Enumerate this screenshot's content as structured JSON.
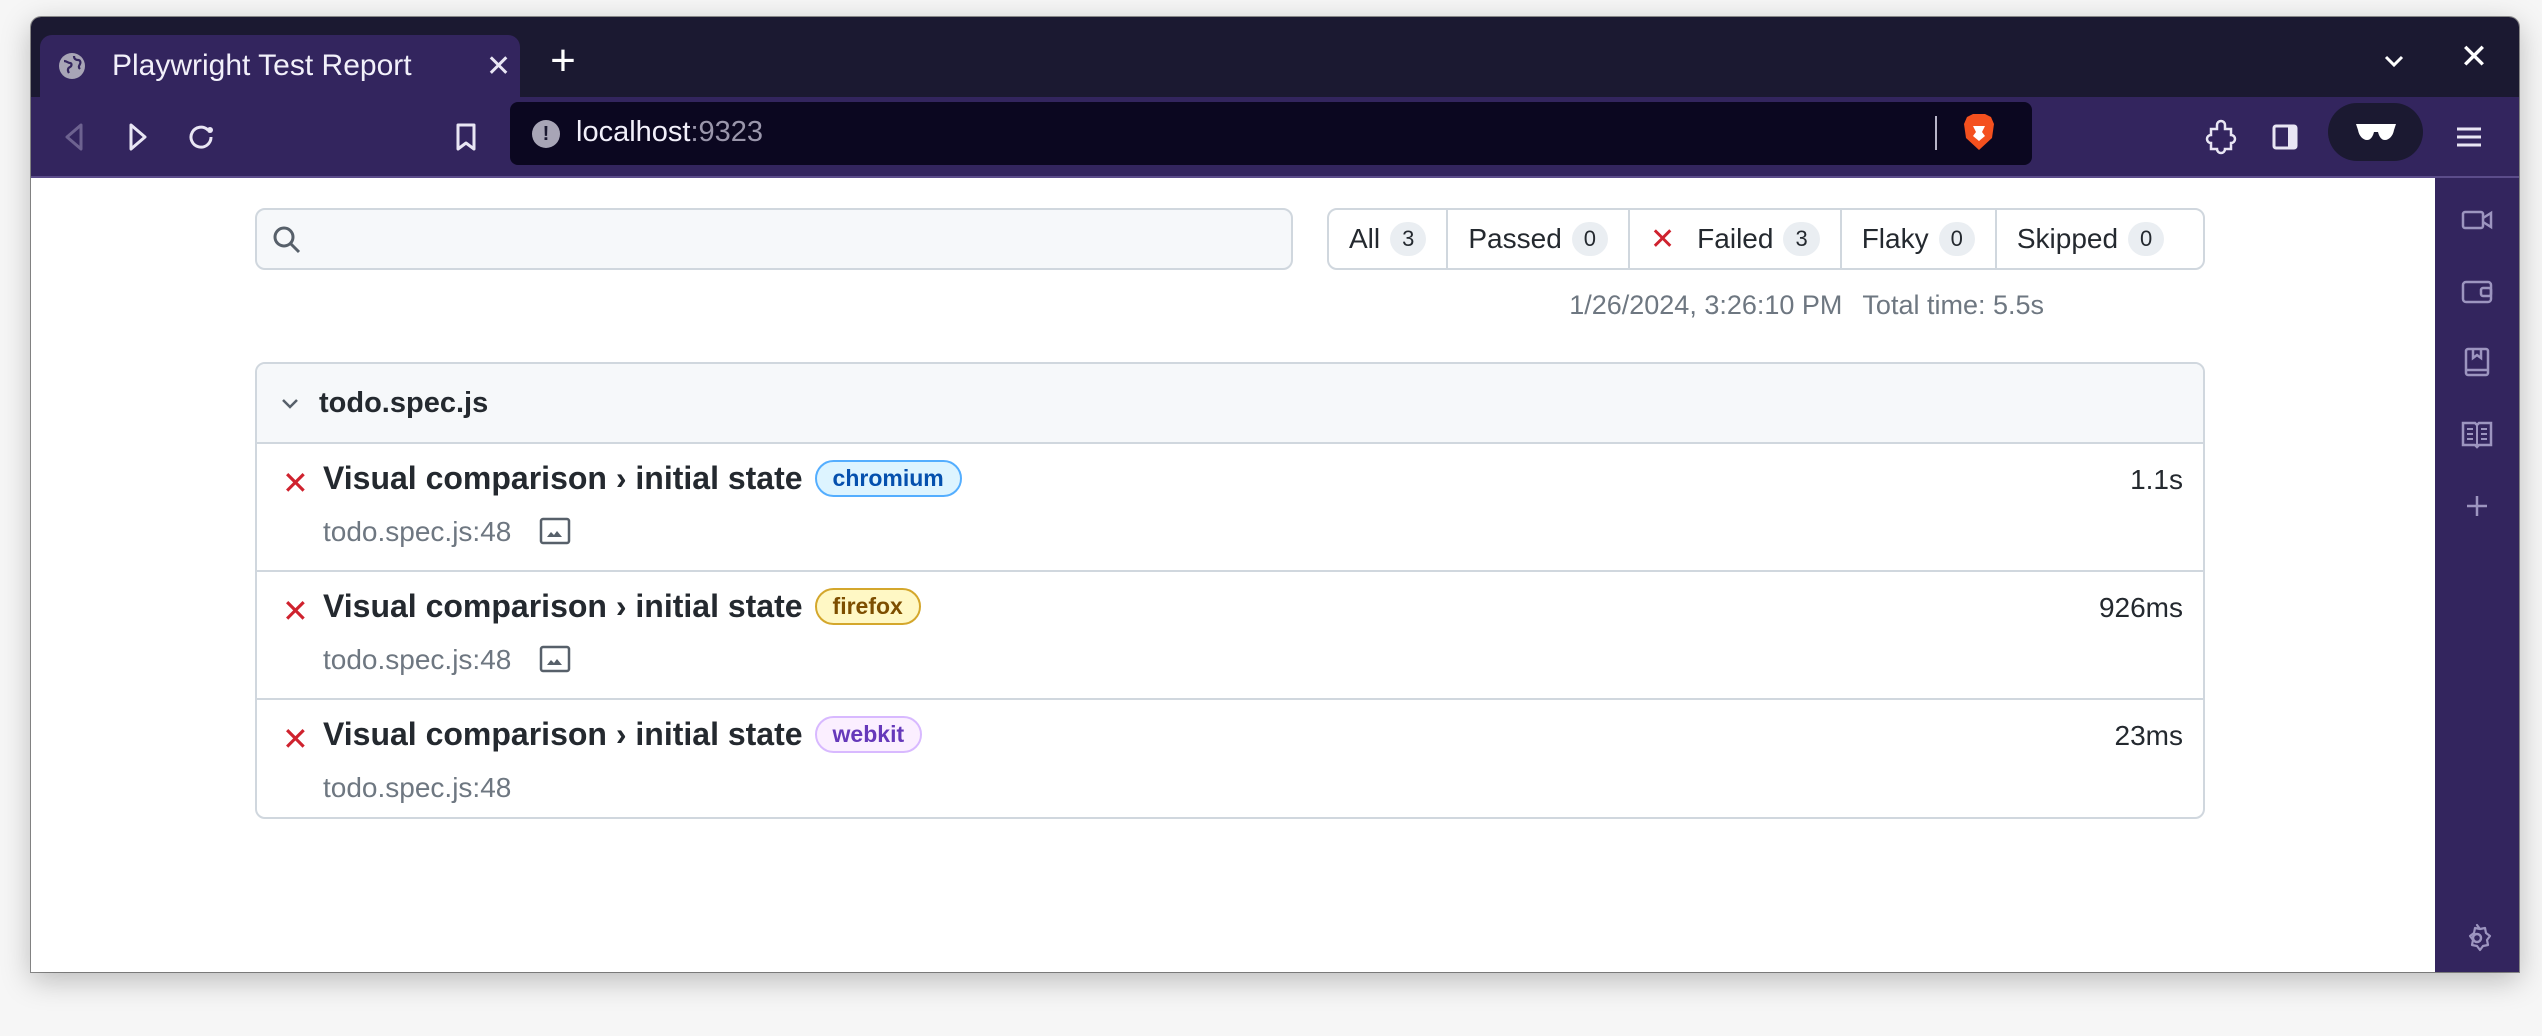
{
  "browser": {
    "tab_title": "Playwright Test Report",
    "url_host": "localhost",
    "url_port": ":9323",
    "accent_color": "#33255e",
    "tabstrip_color": "#1b1931"
  },
  "report": {
    "search_placeholder": "",
    "search_value": "",
    "filters": [
      {
        "label": "All",
        "count": "3"
      },
      {
        "label": "Passed",
        "count": "0"
      },
      {
        "label": "Failed",
        "count": "3"
      },
      {
        "label": "Flaky",
        "count": "0"
      },
      {
        "label": "Skipped",
        "count": "0"
      }
    ],
    "timestamp": "1/26/2024, 3:26:10 PM",
    "total_time": "Total time: 5.5s",
    "file": {
      "name": "todo.spec.js",
      "tests": [
        {
          "status": "failed",
          "title": "Visual comparison › initial state",
          "project": "chromium",
          "duration": "1.1s",
          "location": "todo.spec.js:48",
          "has_image": true
        },
        {
          "status": "failed",
          "title": "Visual comparison › initial state",
          "project": "firefox",
          "duration": "926ms",
          "location": "todo.spec.js:48",
          "has_image": true
        },
        {
          "status": "failed",
          "title": "Visual comparison › initial state",
          "project": "webkit",
          "duration": "23ms",
          "location": "todo.spec.js:48",
          "has_image": false
        }
      ]
    },
    "status_colors": {
      "failed": "#cf222e"
    }
  }
}
